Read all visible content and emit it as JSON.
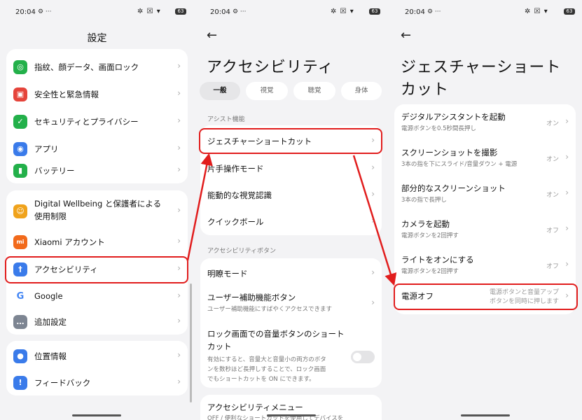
{
  "status": {
    "time": "20:04",
    "icons": "✲ ☒ ▾",
    "battery": "63"
  },
  "colors": {
    "highlight": "#e11d1d",
    "arrow": "#e11d1d"
  },
  "settings": {
    "title": "設定",
    "items": [
      {
        "label": "指紋、顔データ、画面ロック",
        "icon": "fingerprint-icon",
        "color": "#23b04a",
        "glyph": "◎"
      },
      {
        "label": "安全性と緊急情報",
        "icon": "emergency-icon",
        "color": "#e5443b",
        "glyph": "▣"
      },
      {
        "label": "セキュリティとプライバシー",
        "icon": "shield-icon",
        "color": "#23b04a",
        "glyph": "✓"
      },
      {
        "label": "アプリ",
        "icon": "apps-icon",
        "color": "#3a7bea",
        "glyph": "◉"
      },
      {
        "label": "バッテリー",
        "icon": "battery-icon",
        "color": "#23b04a",
        "glyph": "▮"
      },
      {
        "label": "Digital Wellbeing と保護者による",
        "label2": "使用制限",
        "icon": "wellbeing-icon",
        "color": "#f0a31c",
        "glyph": "☺"
      },
      {
        "label": "Xiaomi アカウント",
        "icon": "xiaomi-icon",
        "color": "#f26a1b",
        "glyph": "mi"
      },
      {
        "label": "アクセシビリティ",
        "icon": "accessibility-icon",
        "color": "#3a7bea",
        "glyph": "†"
      },
      {
        "label": "Google",
        "icon": "google-icon",
        "color": "#ffffff",
        "glyph": "G"
      },
      {
        "label": "追加設定",
        "icon": "more-settings-icon",
        "color": "#7d8592",
        "glyph": "…"
      },
      {
        "label": "位置情報",
        "icon": "location-icon",
        "color": "#3a7bea",
        "glyph": "●"
      },
      {
        "label": "フィードバック",
        "icon": "feedback-icon",
        "color": "#3a7bea",
        "glyph": "!"
      }
    ]
  },
  "accessibility": {
    "title": "アクセシビリティ",
    "tabs": [
      "一般",
      "視覚",
      "聴覚",
      "身体"
    ],
    "section1": "アシスト機能",
    "items1": [
      "ジェスチャーショートカット",
      "片手操作モード",
      "能動的な視覚認識",
      "クイックボール"
    ],
    "section2": "アクセシビリティボタン",
    "clarity": "明瞭モード",
    "assist_button": {
      "label": "ユーザー補助機能ボタン",
      "sub": "ユーザー補助機能にすばやくアクセスできます"
    },
    "lock_shortcut": {
      "label": "ロック画面での音量ボタンのショート",
      "label2": "カット",
      "sub1": "有効にすると、音量大と音量小の両方のボタ",
      "sub2": "ンを数秒ほど長押しすることで、ロック画面",
      "sub3": "でもショートカットを ON にできます。"
    },
    "menu": {
      "label": "アクセシビリティメニュー",
      "sub": "OFF / 便利なショートカットを使用してデバイスを"
    }
  },
  "gestures": {
    "title1": "ジェスチャーショート",
    "title2": "カット",
    "items": [
      {
        "label": "デジタルアシスタントを起動",
        "sub": "電源ボタンを0.5秒間長押し",
        "value": "オン"
      },
      {
        "label": "スクリーンショットを撮影",
        "sub": "3本の指を下にスライド/音量ダウン + 電源",
        "value": "オン"
      },
      {
        "label": "部分的なスクリーンショット",
        "sub": "3本の指で長押し",
        "value": "オン"
      },
      {
        "label": "カメラを起動",
        "sub": "電源ボタンを2回押す",
        "value": "オフ"
      },
      {
        "label": "ライトをオンにする",
        "sub": "電源ボタンを2回押す",
        "value": "オフ"
      },
      {
        "label": "電源オフ",
        "value1": "電源ボタンと音量アップ",
        "value2": "ボタンを同時に押します"
      }
    ]
  }
}
